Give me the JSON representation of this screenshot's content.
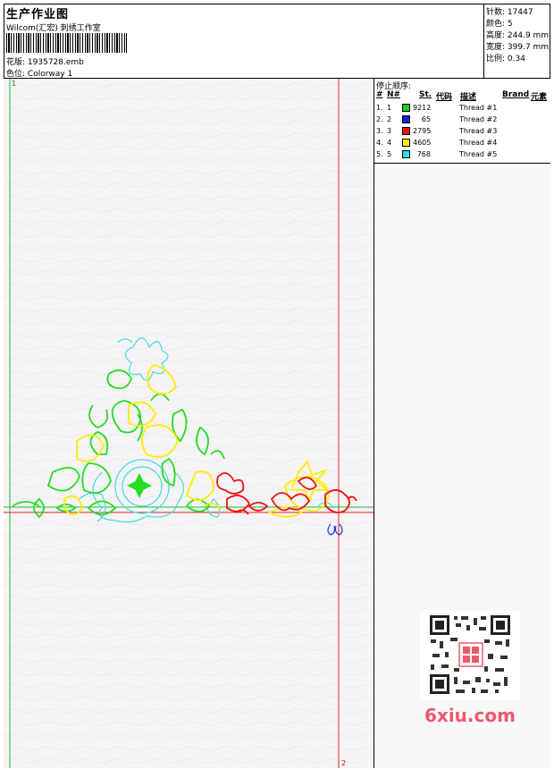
{
  "header": {
    "title": "生产作业图",
    "subtitle": "Wilcom(汇宏) 刺绣工作室",
    "design_label": "花版:",
    "design_value": "1935728.emb",
    "colorway_label": "色位:",
    "colorway_value": "Colorway 1"
  },
  "stats": [
    {
      "label": "针数:",
      "value": "17447"
    },
    {
      "label": "颜色:",
      "value": "5"
    },
    {
      "label": "高度:",
      "value": "244.9 mm"
    },
    {
      "label": "宽度:",
      "value": "399.7 mm"
    },
    {
      "label": "比例:",
      "value": "0.34"
    }
  ],
  "canvas": {
    "marker_start": "1",
    "marker_end": "2"
  },
  "stop_sequence": {
    "title": "停止顺序:",
    "columns": [
      "#",
      "N#",
      "St.",
      "代码",
      "描述",
      "Brand",
      "元素"
    ],
    "rows": [
      {
        "index": "1.",
        "n": "1",
        "color": "#22cc22",
        "code": "9212",
        "desc": "Thread #1"
      },
      {
        "index": "2.",
        "n": "2",
        "color": "#1122dd",
        "code": "65",
        "desc": "Thread #2"
      },
      {
        "index": "3.",
        "n": "3",
        "color": "#ee1111",
        "code": "2795",
        "desc": "Thread #3"
      },
      {
        "index": "4.",
        "n": "4",
        "color": "#ffee00",
        "code": "4605",
        "desc": "Thread #4"
      },
      {
        "index": "5.",
        "n": "5",
        "color": "#33dddd",
        "code": "768",
        "desc": "Thread #5"
      }
    ]
  },
  "watermark": {
    "text": "6xiu.com"
  }
}
